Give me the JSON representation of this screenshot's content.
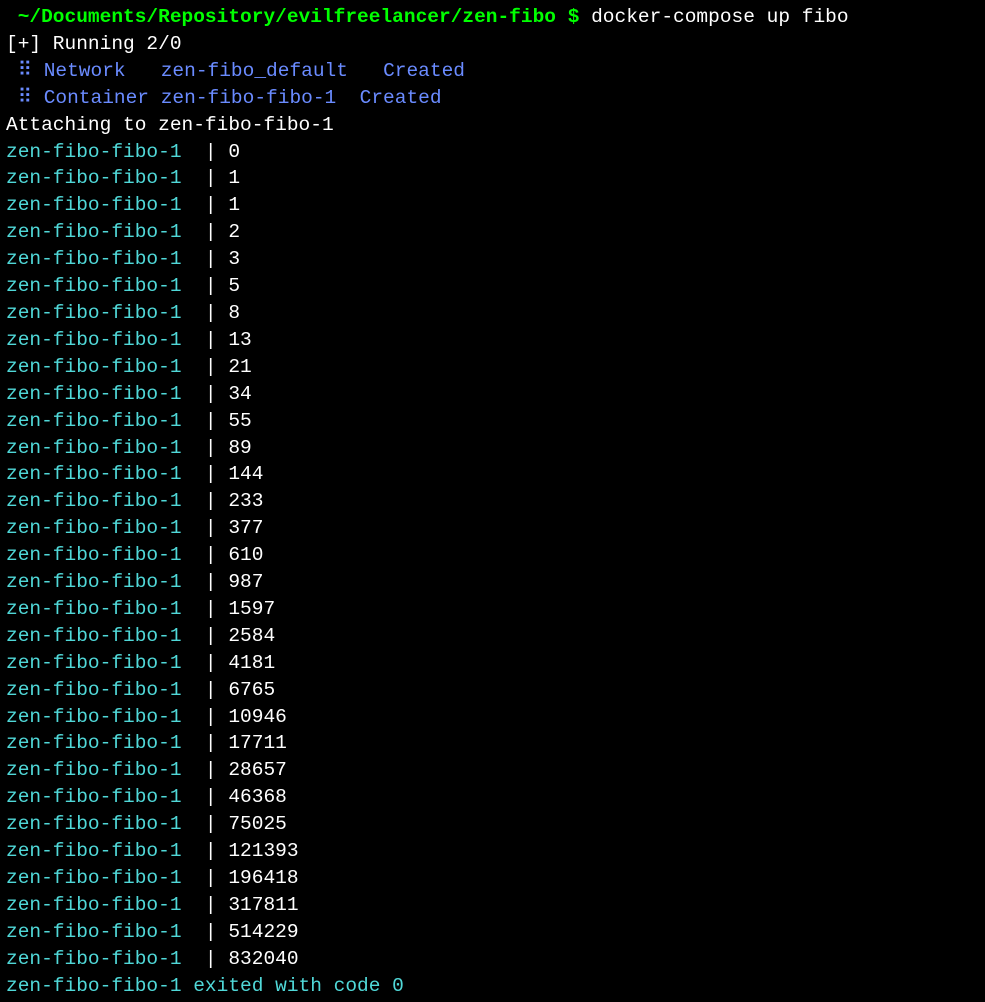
{
  "prompt": {
    "path": " ~/Documents/Repository/evilfreelancer/zen-fibo ",
    "dollar": "$",
    "command": " docker-compose up fibo"
  },
  "running": {
    "text": "[+] Running 2/0"
  },
  "resources": [
    {
      "braille": " ⠿ ",
      "type": "Network",
      "name": "zen-fibo_default  ",
      "status": "Created"
    },
    {
      "braille": " ⠿ ",
      "type": "Container",
      "name": "zen-fibo-fibo-1 ",
      "status": "Created"
    }
  ],
  "attaching": "Attaching to zen-fibo-fibo-1",
  "log_prefix": "zen-fibo-fibo-1",
  "pipe": " | ",
  "fibonacci": [
    "0",
    "1",
    "1",
    "2",
    "3",
    "5",
    "8",
    "13",
    "21",
    "34",
    "55",
    "89",
    "144",
    "233",
    "377",
    "610",
    "987",
    "1597",
    "2584",
    "4181",
    "6765",
    "10946",
    "17711",
    "28657",
    "46368",
    "75025",
    "121393",
    "196418",
    "317811",
    "514229",
    "832040"
  ],
  "exit": {
    "prefix": "zen-fibo-fibo-1",
    "text": " exited with code 0"
  }
}
